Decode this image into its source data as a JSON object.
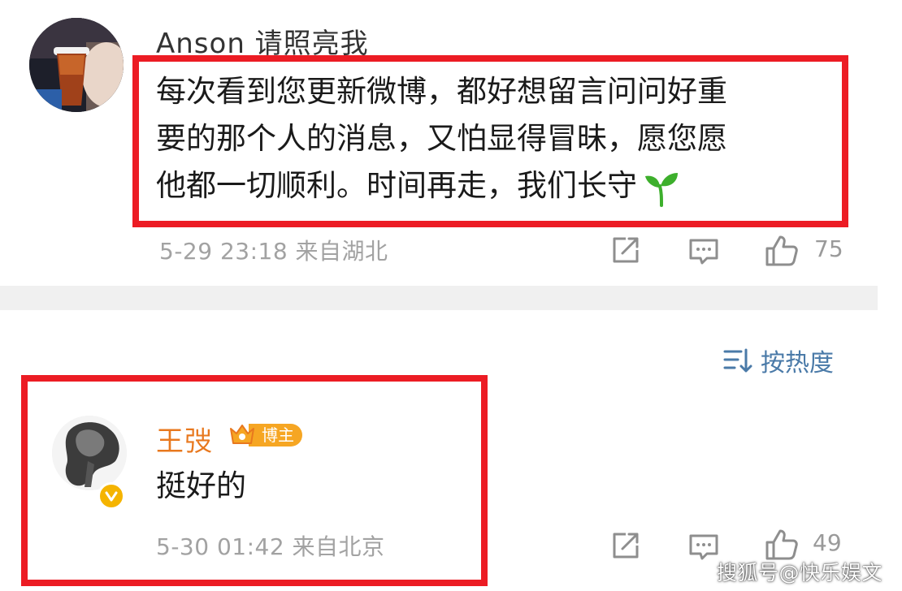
{
  "comment1": {
    "username": "Anson 请照亮我",
    "avatar_icon": "drink-cup-photo",
    "text_lines": [
      "每次看到您更新微博，都好想留言问问好重",
      "要的那个人的消息，又怕显得冒昧，愿您愿",
      "他都一切顺利。时间再走，我们长守"
    ],
    "emoji": "seedling-icon",
    "meta": "5-29 23:18 来自湖北",
    "like_count": "75"
  },
  "sort": {
    "label": "按热度",
    "icon": "sort-lines-icon"
  },
  "comment2": {
    "username": "王弢",
    "badge_label": "博主",
    "avatar_icon": "sculpture-photo",
    "text": "挺好的",
    "meta": "5-30 01:42 来自北京",
    "like_count": "49"
  },
  "watermark": "搜狐号@快乐娱文",
  "colors": {
    "highlight_box": "#ec1c24",
    "username_orange": "#e8781e",
    "badge_orange": "#f6a623",
    "meta_gray": "#a2a2a2",
    "sort_blue": "#4a7aa8",
    "divider_gray": "#f0f0f0",
    "seedling_green": "#3daf2c",
    "verified_yellow": "#f5b400"
  }
}
